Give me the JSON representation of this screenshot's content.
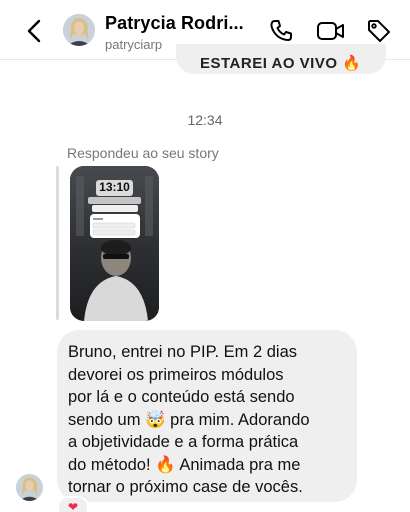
{
  "header": {
    "contact_name": "Patrycia Rodri...",
    "username": "patryciarp"
  },
  "previous_message": {
    "text": "ESTAREI AO VIVO 🔥"
  },
  "timestamp": "12:34",
  "story_reply": {
    "label": "Respondeu ao seu story",
    "story_clock": "13:10"
  },
  "message": {
    "lines": [
      "Bruno, entrei no PIP. Em 2 dias",
      "devorei os primeiros módulos",
      "por lá e o conteúdo está sendo",
      "sendo um 🤯 pra mim. Adorando",
      "a objetividade e a forma prática",
      "do método! 🔥 Animada pra me",
      "tornar o próximo case de vocês."
    ]
  },
  "reaction": {
    "emoji": "❤"
  },
  "icons": {
    "back": "chevron-left-icon",
    "call": "phone-icon",
    "video": "video-camera-icon",
    "tag": "tag-icon"
  },
  "colors": {
    "bubble": "#efefef",
    "text": "#111111",
    "muted": "#777777",
    "reaction": "#ed2a4f"
  }
}
